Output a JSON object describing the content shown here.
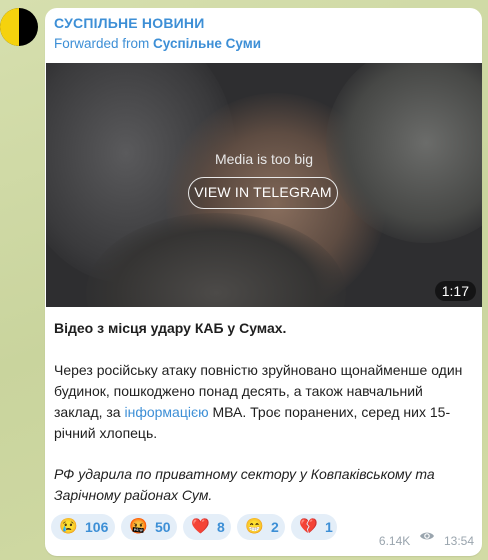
{
  "channel": {
    "name": "СУСПІЛЬНЕ НОВИНИ",
    "forwarded_prefix": "Forwarded from",
    "forwarded_source": "Суспільне Суми"
  },
  "media": {
    "message": "Media is too big",
    "button_label": "VIEW IN TELEGRAM",
    "duration": "1:17"
  },
  "post": {
    "title": "Відео з місця удару КАБ у Сумах.",
    "body_part1": "Через російську атаку повністю зруйновано щонайменше один будинок, пошкоджено понад десять, а також навчальний заклад, за ",
    "body_link": "інформацією",
    "body_part2": " МВА. Троє поранених, серед них 15-річний хлопець.",
    "italic": "РФ ударила по приватному сектору у Ковпаківському та Зарічному районах Сум."
  },
  "reactions": [
    {
      "emoji": "😢",
      "name": "crying-face-icon",
      "count": "106"
    },
    {
      "emoji": "🤬",
      "name": "cursing-face-icon",
      "count": "50"
    },
    {
      "emoji": "❤️",
      "name": "red-heart-icon",
      "count": "8"
    },
    {
      "emoji": "😁",
      "name": "grinning-face-icon",
      "count": "2"
    },
    {
      "emoji": "💔",
      "name": "broken-heart-icon",
      "count": "1"
    }
  ],
  "meta": {
    "views": "6.14K",
    "time": "13:54"
  },
  "colors": {
    "accent": "#3d8fd6",
    "avatar_yellow": "#f5d20d",
    "avatar_black": "#000000"
  }
}
